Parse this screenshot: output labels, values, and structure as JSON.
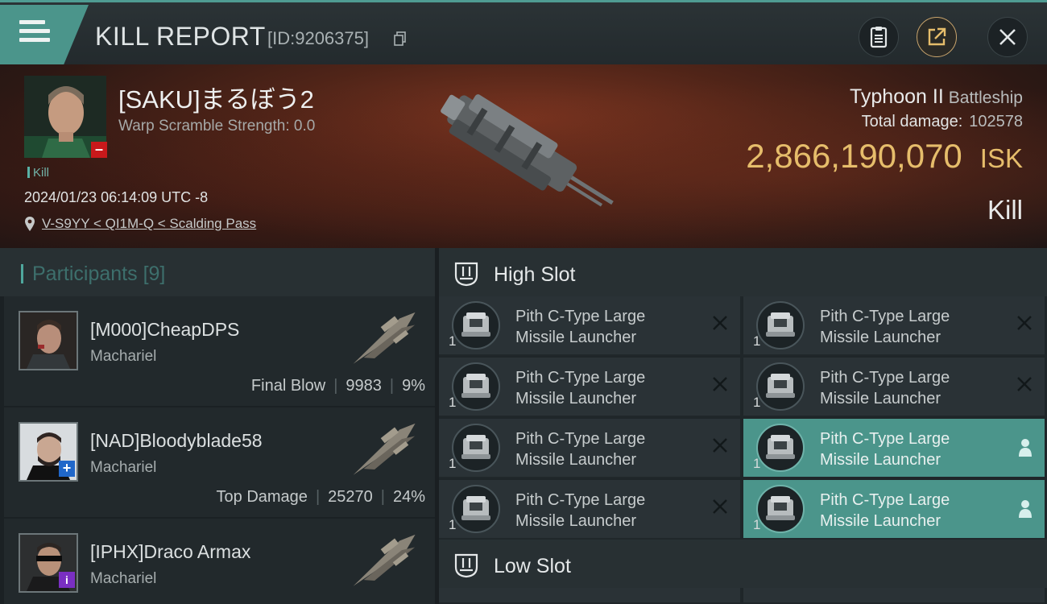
{
  "header": {
    "title": "KILL REPORT",
    "kill_id": "[ID:9206375]"
  },
  "victim": {
    "name": "[SAKU]まるぼう2",
    "scramble": "Warp Scramble Strength: 0.0",
    "tag": "Kill",
    "datetime": "2024/01/23 06:14:09 UTC -8",
    "location": "V-S9YY < QI1M-Q < Scalding Pass",
    "ship": "Typhoon II",
    "ship_class": "Battleship",
    "total_damage_label": "Total damage:",
    "total_damage": "102578",
    "isk_value": "2,866,190,070",
    "isk_unit": "ISK",
    "result": "Kill"
  },
  "participants": {
    "title": "Participants",
    "count": "[9]",
    "rows": [
      {
        "name": "[M000]CheapDPS",
        "ship": "Machariel",
        "label": "Final Blow",
        "damage": "9983",
        "percent": "9%"
      },
      {
        "name": "[NAD]Bloodyblade58",
        "ship": "Machariel",
        "label": "Top Damage",
        "damage": "25270",
        "percent": "24%"
      },
      {
        "name": "[IPHX]Draco Armax",
        "ship": "Machariel",
        "label": "",
        "damage": "",
        "percent": ""
      }
    ]
  },
  "slots": {
    "high_title": "High Slot",
    "low_title": "Low Slot",
    "module_line1": "Pith C-Type Large",
    "module_line2": "Missile Launcher",
    "qty": "1",
    "modules": [
      {
        "status": "destroyed"
      },
      {
        "status": "destroyed"
      },
      {
        "status": "destroyed"
      },
      {
        "status": "destroyed"
      },
      {
        "status": "destroyed"
      },
      {
        "status": "dropped"
      },
      {
        "status": "destroyed"
      },
      {
        "status": "dropped"
      }
    ]
  },
  "colors": {
    "accent": "#4b958b",
    "isk": "#e6bd6b",
    "badge_red": "#c8191b",
    "badge_blue": "#2067c9",
    "badge_purple": "#7a2fc2"
  }
}
